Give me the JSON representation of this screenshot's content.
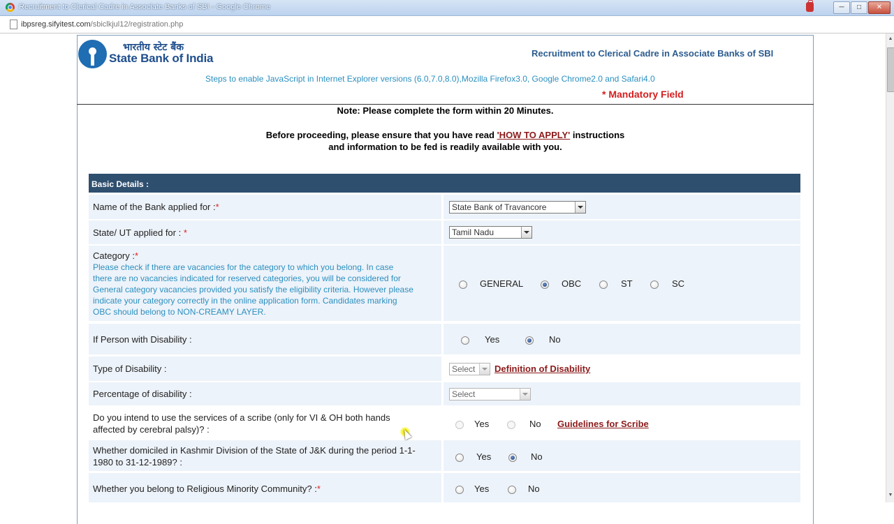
{
  "window": {
    "title": "Recruitment to Clerical Cadre in Associate Banks of SBI - Google Chrome",
    "url_host": "ibpsreg.sifyitest.com",
    "url_path": "/sbiclkjul12/registration.php"
  },
  "header": {
    "logo_hindi": "भारतीय स्टेट बैंक",
    "logo_text": "State Bank of India",
    "title": "Recruitment to Clerical Cadre in Associate Banks of SBI",
    "steps": "Steps to enable JavaScript in Internet Explorer versions (6.0,7.0,8.0),Mozilla Firefox3.0, Google Chrome2.0 and Safari4.0",
    "mandatory": "* Mandatory Field"
  },
  "instructions": {
    "note": "Note: Please complete the form within 20 Minutes.",
    "proceed_before": "Before proceeding, please ensure that you have read ",
    "how_to_apply": "'HOW TO APPLY'",
    "proceed_after": " instructions",
    "proceed_line2": "and information to be fed is readily available with you."
  },
  "section": {
    "title": "Basic Details :"
  },
  "form": {
    "bank": {
      "label": "Name of the Bank applied for :",
      "star": "*",
      "value": "State Bank of Travancore"
    },
    "state": {
      "label": "State/ UT applied for : ",
      "star": "*",
      "value": "Tamil Nadu"
    },
    "category": {
      "label": "Category :",
      "star": "*",
      "note_lines": [
        "Please check if there are vacancies for the category to which you belong. In case",
        "there are no vacancies indicated for reserved categories, you will be considered for",
        "General category vacancies provided you satisfy the eligibility criteria. However please",
        "indicate your category correctly in the online application form. Candidates marking",
        "OBC should belong to NON-CREAMY LAYER."
      ],
      "options": [
        "GENERAL",
        "OBC",
        "ST",
        "SC"
      ],
      "selected": "OBC"
    },
    "disability": {
      "label": "If Person with Disability :",
      "options": [
        "Yes",
        "No"
      ],
      "selected": "No"
    },
    "disability_type": {
      "label": "Type of Disability :",
      "value": "Select",
      "link": "Definition of Disability"
    },
    "disability_pct": {
      "label": "Percentage of disability :",
      "value": "Select"
    },
    "scribe": {
      "label_line1": "Do you intend to use the services of a scribe (only for VI & OH both hands",
      "label_line2": "affected by cerebral palsy)? :",
      "options": [
        "Yes",
        "No"
      ],
      "link": "Guidelines for Scribe "
    },
    "kashmir": {
      "label_line1": "Whether domiciled in Kashmir Division of the State of J&K during the period 1-1-",
      "label_line2": "1980 to 31-12-1989? :",
      "options": [
        "Yes",
        "No"
      ],
      "selected": "No"
    },
    "minority": {
      "label": "Whether you belong to Religious Minority Community? :",
      "star": "*",
      "options": [
        "Yes",
        "No"
      ]
    }
  }
}
